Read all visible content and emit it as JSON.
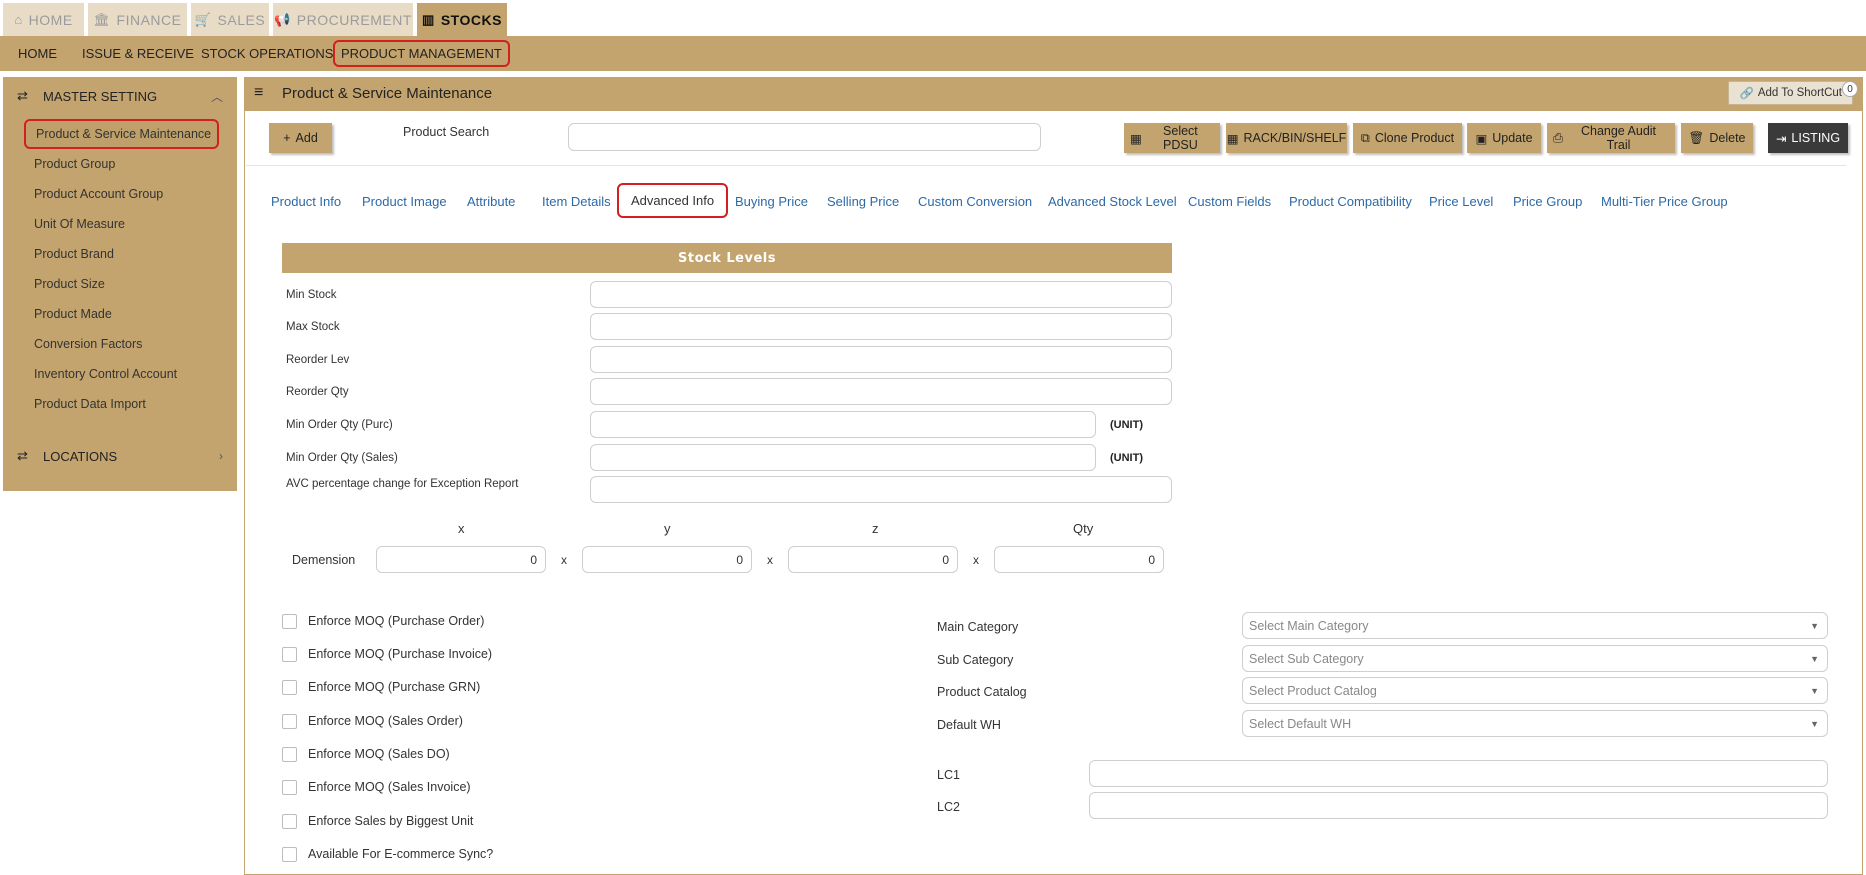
{
  "top_tabs": [
    {
      "label": "HOME",
      "icon": "home-icon"
    },
    {
      "label": "FINANCE",
      "icon": "bank-icon"
    },
    {
      "label": "SALES",
      "icon": "cart-icon"
    },
    {
      "label": "PROCUREMENT",
      "icon": "bullhorn-icon"
    },
    {
      "label": "STOCKS",
      "icon": "bar-chart-icon"
    }
  ],
  "sub_nav": [
    "HOME",
    "ISSUE & RECEIVE",
    "STOCK OPERATIONS",
    "PRODUCT MANAGEMENT"
  ],
  "sidebar": {
    "master_setting": "MASTER SETTING",
    "items": [
      "Product & Service Maintenance",
      "Product Group",
      "Product Account Group",
      "Unit Of Measure",
      "Product Brand",
      "Product Size",
      "Product Made",
      "Conversion Factors",
      "Inventory Control Account",
      "Product Data Import"
    ],
    "locations": "LOCATIONS"
  },
  "main": {
    "title": "Product & Service Maintenance",
    "shortcut_label": "Add To ShortCut",
    "shortcut_count": "0"
  },
  "toolbar": {
    "add": "Add",
    "search_label": "Product Search",
    "search_value": "",
    "select_pdsu": "Select PDSU",
    "rack": "RACK/BIN/SHELF",
    "clone": "Clone Product",
    "update": "Update",
    "audit": "Change Audit Trail",
    "delete": "Delete",
    "listing": "LISTING"
  },
  "tabs": [
    "Product Info",
    "Product Image",
    "Attribute",
    "Item Details",
    "Advanced Info",
    "Buying Price",
    "Selling Price",
    "Custom Conversion",
    "Advanced Stock Level",
    "Custom Fields",
    "Product Compatibility",
    "Price Level",
    "Price Group",
    "Multi-Tier Price Group"
  ],
  "stock_levels": {
    "title": "Stock Levels",
    "fields": [
      "Min Stock",
      "Max Stock",
      "Reorder Lev",
      "Reorder Qty",
      "Min Order Qty (Purc)",
      "Min Order Qty (Sales)",
      "AVC percentage change for Exception Report"
    ],
    "unit": "(UNIT)"
  },
  "dimension": {
    "label": "Demension",
    "headers": [
      "x",
      "y",
      "z",
      "Qty"
    ],
    "values": [
      "0",
      "0",
      "0",
      "0"
    ],
    "sep": "x"
  },
  "checkboxes": [
    "Enforce MOQ (Purchase Order)",
    "Enforce MOQ (Purchase Invoice)",
    "Enforce MOQ (Purchase GRN)",
    "Enforce MOQ (Sales Order)",
    "Enforce MOQ (Sales DO)",
    "Enforce MOQ (Sales Invoice)",
    "Enforce Sales by Biggest Unit",
    "Available For E-commerce Sync?"
  ],
  "categories": [
    {
      "label": "Main Category",
      "placeholder": "Select Main Category"
    },
    {
      "label": "Sub Category",
      "placeholder": "Select Sub Category"
    },
    {
      "label": "Product Catalog",
      "placeholder": "Select Product Catalog"
    },
    {
      "label": "Default WH",
      "placeholder": "Select Default WH"
    }
  ],
  "lc": [
    "LC1",
    "LC2"
  ],
  "colors": {
    "accent": "#c4a46e",
    "highlight": "#d21f1f",
    "link": "#2b6aa8"
  }
}
